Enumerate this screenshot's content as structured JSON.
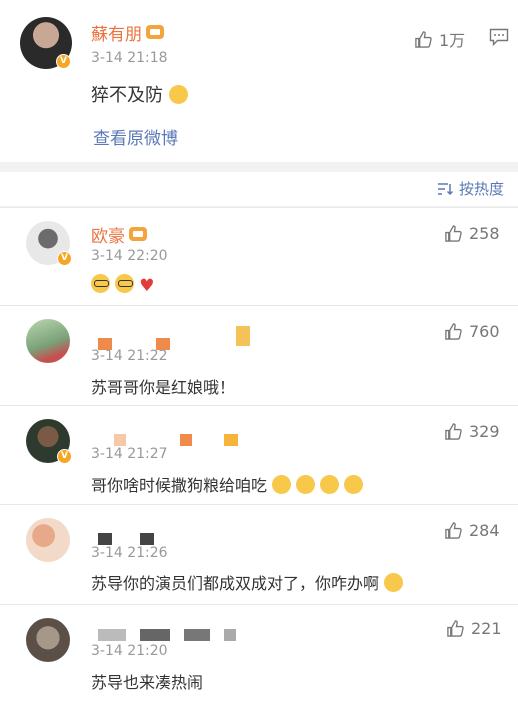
{
  "post": {
    "author": "蘇有朋",
    "time": "3-14 21:18",
    "text": "猝不及防",
    "likes": "1万",
    "view_original": "查看原微博"
  },
  "sort": {
    "label": "按热度"
  },
  "comments": [
    {
      "author": "欧豪",
      "time": "3-14 22:20",
      "text": "",
      "likes": "258"
    },
    {
      "author": "",
      "time": "3-14 21:22",
      "text": "苏哥哥你是红娘哦！",
      "likes": "760"
    },
    {
      "author": "",
      "time": "3-14 21:27",
      "text": "哥你啥时候撒狗粮给咱吃",
      "likes": "329"
    },
    {
      "author": "",
      "time": "3-14 21:26",
      "text": "苏导你的演员们都成双成对了，你咋办啊",
      "likes": "284"
    },
    {
      "author": "",
      "time": "3-14 21:20",
      "text": "苏导也来凑热闹",
      "likes": "221"
    }
  ],
  "icons": {
    "like": "thumb-up-icon",
    "comment": "comment-bubble-icon",
    "sort": "sort-icon",
    "verified": "verified-v-icon",
    "member": "member-crown-icon"
  },
  "colors": {
    "name": "#eb7340",
    "link": "#5b7ab5",
    "meta": "#999999"
  }
}
